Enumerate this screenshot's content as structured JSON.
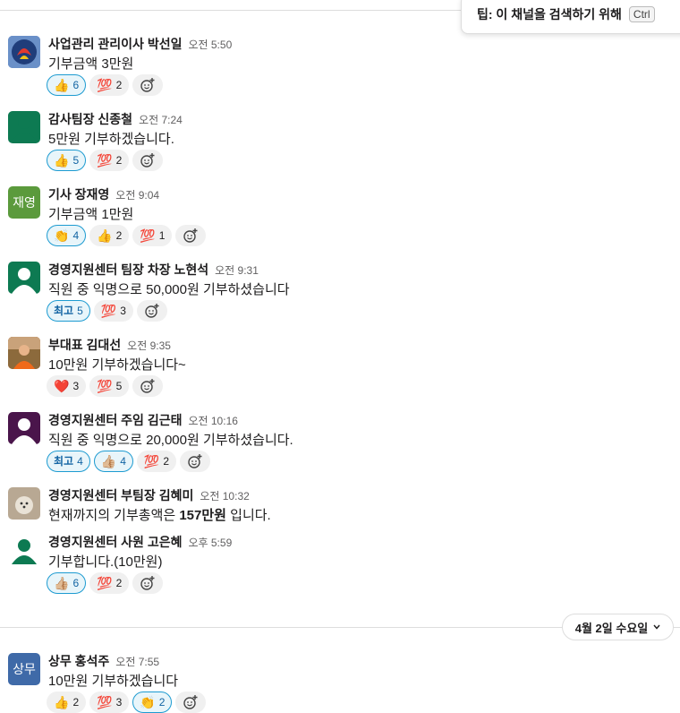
{
  "tip": {
    "text": "팁: 이 채널을 검색하기 위해",
    "key": "Ctrl"
  },
  "date_divider": {
    "label": "4월 2일 수요일"
  },
  "messages": [
    {
      "name": "사업관리 관리이사 박선일",
      "time": "오전 5:50",
      "text": "기부금액 3만원",
      "reactions": [
        {
          "emoji": "👍",
          "count": "6",
          "mine": true
        },
        {
          "emoji": "💯",
          "count": "2",
          "mine": false
        }
      ]
    },
    {
      "name": "감사팀장 신종철",
      "time": "오전 7:24",
      "text": "5만원 기부하겠습니다.",
      "reactions": [
        {
          "emoji": "👍",
          "count": "5",
          "mine": true
        },
        {
          "emoji": "💯",
          "count": "2",
          "mine": false
        }
      ]
    },
    {
      "name": "기사 장재영",
      "time": "오전 9:04",
      "text": "기부금액 1만원",
      "avatar_text": "재영",
      "reactions": [
        {
          "emoji": "👏",
          "count": "4",
          "mine": true
        },
        {
          "emoji": "👍",
          "count": "2",
          "mine": false
        },
        {
          "emoji": "💯",
          "count": "1",
          "mine": false
        }
      ]
    },
    {
      "name": "경영지원센터 팀장 차장 노현석",
      "time": "오전 9:31",
      "text": "직원 중 익명으로 50,000원 기부하셨습니다",
      "reactions": [
        {
          "emoji": "최고",
          "count": "5",
          "mine": true
        },
        {
          "emoji": "💯",
          "count": "3",
          "mine": false
        }
      ]
    },
    {
      "name": "부대표 김대선",
      "time": "오전 9:35",
      "text": "10만원 기부하겠습니다~",
      "reactions": [
        {
          "emoji": "❤️",
          "count": "3",
          "mine": false
        },
        {
          "emoji": "💯",
          "count": "5",
          "mine": false
        }
      ]
    },
    {
      "name": "경영지원센터 주임 김근태",
      "time": "오전 10:16",
      "text": "직원 중 익명으로 20,000원 기부하셨습니다.",
      "reactions": [
        {
          "emoji": "최고",
          "count": "4",
          "mine": true
        },
        {
          "emoji": "👍🏼",
          "count": "4",
          "mine": true
        },
        {
          "emoji": "💯",
          "count": "2",
          "mine": false
        }
      ]
    },
    {
      "name": "경영지원센터 부팀장 김혜미",
      "time": "오전 10:32",
      "text_prefix": "현재까지의 기부총액은 ",
      "text_bold": "157만원",
      "text_suffix": " 입니다.",
      "reactions": []
    },
    {
      "name": "경영지원센터 사원 고은혜",
      "time": "오후 5:59",
      "text": "기부합니다.(10만원)",
      "reactions": [
        {
          "emoji": "👍🏼",
          "count": "6",
          "mine": true
        },
        {
          "emoji": "💯",
          "count": "2",
          "mine": false
        }
      ]
    },
    {
      "name": "상무 홍석주",
      "time": "오전 7:55",
      "text": "10만원 기부하겠습니다",
      "avatar_text": "상무",
      "reactions": [
        {
          "emoji": "👍",
          "count": "2",
          "mine": false
        },
        {
          "emoji": "💯",
          "count": "3",
          "mine": false
        },
        {
          "emoji": "👏",
          "count": "2",
          "mine": true
        }
      ]
    }
  ]
}
